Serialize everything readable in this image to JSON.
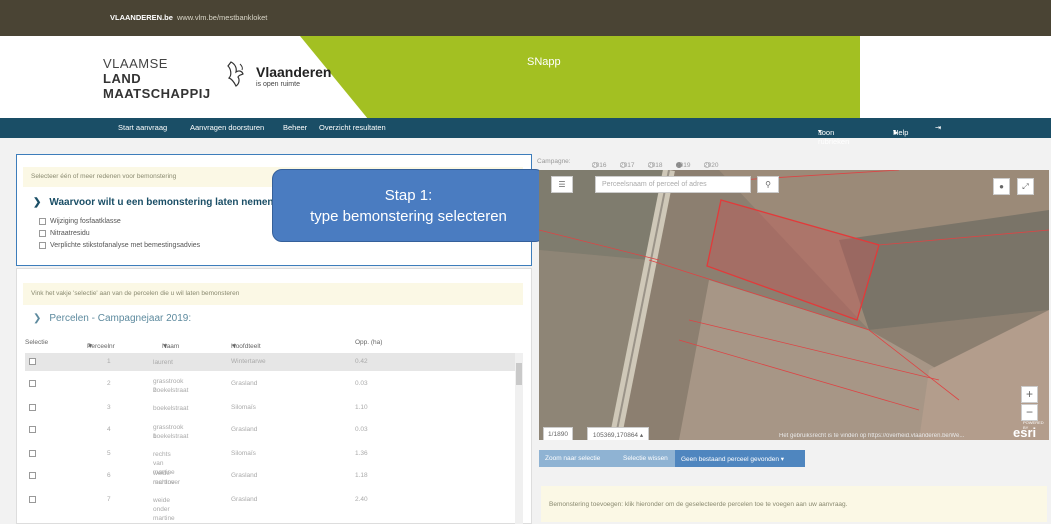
{
  "topbar": {
    "site_bold": "VLAANDEREN.be",
    "site_url": "www.vlm.be/mestbankloket"
  },
  "header": {
    "logo_line1": "VLAAMSE",
    "logo_line2": "LAND",
    "logo_line3": "MAATSCHAPPIJ",
    "vl_name": "Vlaanderen",
    "vl_tagline": "is open ruimte",
    "app_name": "SNapp"
  },
  "nav": {
    "items": [
      "Start aanvraag",
      "Aanvragen doorsturen",
      "Beheer",
      "Overzicht resultaten"
    ],
    "right": {
      "rubrieken": "Toon rubrieken",
      "help": "Help"
    }
  },
  "reden": {
    "hint": "Selecteer één of meer redenen voor bemonstering",
    "question": "Waarvoor wilt u een bemonstering laten nemen?",
    "options": [
      "Wijziging fosfaatklasse",
      "Nitraatresidu",
      "Verplichte stikstofanalyse met bemestingsadvies"
    ]
  },
  "callout": {
    "line1": "Stap 1:",
    "line2": "type bemonstering selecteren"
  },
  "percelen": {
    "hint": "Vink het vakje 'selectie' aan van de percelen die u wil laten bemonsteren",
    "title": "Percelen - Campagnejaar 2019:",
    "headers": [
      "Selectie",
      "Perceelnr",
      "Naam",
      "Hoofdteelt",
      "Opp. (ha)"
    ],
    "rows": [
      [
        "1",
        "laurent",
        "",
        "Wintertarwe",
        "0.42"
      ],
      [
        "2",
        "grasstrook 2",
        "boekelstraat",
        "Grasland",
        "0.03"
      ],
      [
        "3",
        "boekelstraat",
        "",
        "Silomaïs",
        "1.10"
      ],
      [
        "4",
        "grasstrook 1",
        "boekelstraat",
        "Grasland",
        "0.03"
      ],
      [
        "5",
        "rechts van martine",
        "",
        "Silomaïs",
        "1.36"
      ],
      [
        "6",
        "weide rechtover",
        "martine",
        "Grasland",
        "1.18"
      ],
      [
        "7",
        "weide onder martine",
        "",
        "Grasland",
        "2.40"
      ]
    ]
  },
  "map": {
    "campaign_label": "Campagne:",
    "years": [
      "2016",
      "2017",
      "2018",
      "2019",
      "2020"
    ],
    "selected_year": "2019",
    "search_placeholder": "Perceelsnaam of perceel of adres",
    "scale": "1/1890",
    "coords": "105369,170864",
    "attribution": "Het gebruiksrecht is te vinden op https://overheid.vlaanderen.be/We...",
    "esri": "esri",
    "powered": "POWERED BY"
  },
  "map_toolbar": {
    "zoom": "Zoom naar selectie",
    "wissen": "Selectie wissen",
    "geen": "Geen bestaand perceel gevonden"
  },
  "bottom_note": "Bemonstering toevoegen: klik hieronder om de geselecteerde percelen toe te voegen aan uw aanvraag."
}
